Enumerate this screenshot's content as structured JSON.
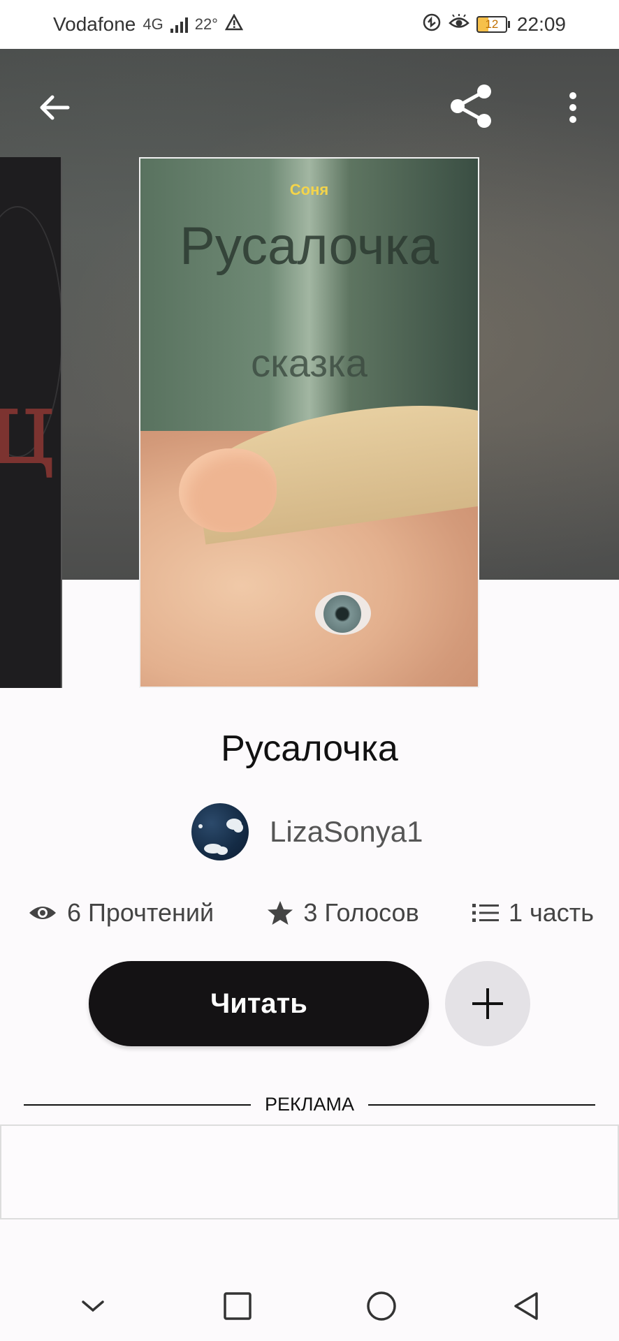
{
  "status_bar": {
    "carrier": "Vodafone",
    "network_type": "4G",
    "temperature": "22°",
    "battery": "12",
    "time": "22:09"
  },
  "header": {
    "back_icon": "arrow-left-icon",
    "share_icon": "share-icon",
    "more_icon": "more-vertical-icon"
  },
  "cover": {
    "author": "Соня",
    "title": "Русалочка",
    "genre": "сказка"
  },
  "book": {
    "title": "Русалочка",
    "author": "LizaSonya1"
  },
  "stats": {
    "reads": "6 Прочтений",
    "votes": "3 Голосов",
    "parts": "1 часть"
  },
  "actions": {
    "read_label": "Читать"
  },
  "ad": {
    "label": "РЕКЛАМА"
  },
  "colors": {
    "primary_button": "#141214",
    "add_button": "#e4e2e6",
    "cover_author": "#f4d44a"
  }
}
